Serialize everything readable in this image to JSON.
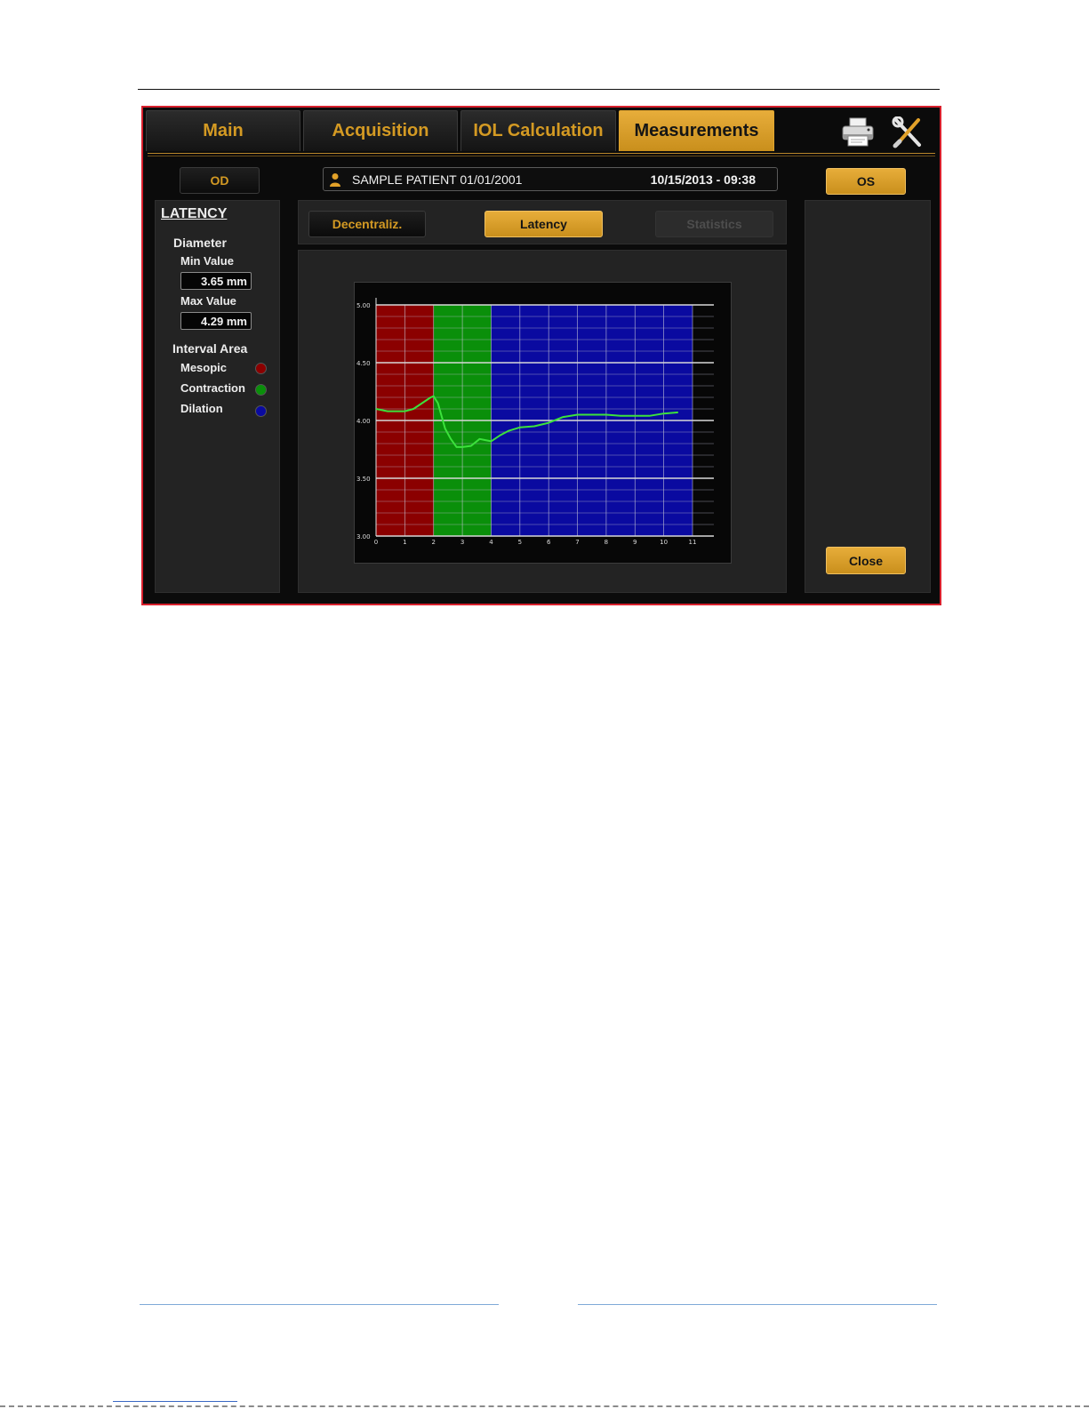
{
  "tabs": [
    {
      "label": "Main"
    },
    {
      "label": "Acquisition"
    },
    {
      "label": "IOL Calculation"
    },
    {
      "label": "Measurements"
    }
  ],
  "active_tab": "Measurements",
  "eyes": {
    "left": "OD",
    "right": "OS",
    "active": "OS"
  },
  "patient": {
    "name": "SAMPLE PATIENT 01/01/2001",
    "datetime": "10/15/2013 - 09:38"
  },
  "left_panel": {
    "title": "LATENCY",
    "diameter_label": "Diameter",
    "min_label": "Min Value",
    "min_value": "3.65 mm",
    "max_label": "Max Value",
    "max_value": "4.29 mm",
    "interval_label": "Interval Area",
    "intervals": [
      {
        "label": "Mesopic",
        "color": "#8b0000"
      },
      {
        "label": "Contraction",
        "color": "#0a8f0a"
      },
      {
        "label": "Dilation",
        "color": "#0a0aa0"
      }
    ]
  },
  "sub_tabs": [
    {
      "label": "Decentraliz.",
      "state": "normal"
    },
    {
      "label": "Latency",
      "state": "active"
    },
    {
      "label": "Statistics",
      "state": "disabled"
    }
  ],
  "close_label": "Close",
  "colors": {
    "accent": "#d49a23",
    "window_border": "#d8202d"
  },
  "chart_data": {
    "type": "line",
    "xlim": [
      0,
      11
    ],
    "ylim": [
      3.0,
      5.0
    ],
    "x_ticks": [
      "0",
      "1",
      "2",
      "3",
      "4",
      "5",
      "6",
      "7",
      "8",
      "9",
      "10",
      "11"
    ],
    "y_ticks": [
      "3.00",
      "3.50",
      "4.00",
      "4.50",
      "5.00"
    ],
    "bands": [
      {
        "from": 0,
        "to": 2,
        "color": "#8b0000"
      },
      {
        "from": 2,
        "to": 4,
        "color": "#0a8f0a"
      },
      {
        "from": 4,
        "to": 11,
        "color": "#0a0aa0"
      }
    ],
    "grid": true,
    "series": [
      {
        "color": "#3ce23c",
        "points": [
          [
            0,
            4.1
          ],
          [
            0.4,
            4.08
          ],
          [
            1.0,
            4.08
          ],
          [
            1.3,
            4.1
          ],
          [
            1.6,
            4.15
          ],
          [
            1.9,
            4.2
          ],
          [
            2.0,
            4.21
          ],
          [
            2.15,
            4.15
          ],
          [
            2.4,
            3.93
          ],
          [
            2.6,
            3.84
          ],
          [
            2.8,
            3.77
          ],
          [
            3.0,
            3.77
          ],
          [
            3.3,
            3.78
          ],
          [
            3.6,
            3.84
          ],
          [
            3.8,
            3.83
          ],
          [
            4.0,
            3.82
          ],
          [
            4.3,
            3.87
          ],
          [
            4.6,
            3.91
          ],
          [
            5.0,
            3.94
          ],
          [
            5.5,
            3.95
          ],
          [
            6.0,
            3.98
          ],
          [
            6.5,
            4.03
          ],
          [
            7.0,
            4.05
          ],
          [
            7.5,
            4.05
          ],
          [
            8.0,
            4.05
          ],
          [
            8.5,
            4.04
          ],
          [
            9.0,
            4.04
          ],
          [
            9.5,
            4.04
          ],
          [
            10.0,
            4.06
          ],
          [
            10.5,
            4.07
          ]
        ]
      }
    ]
  }
}
